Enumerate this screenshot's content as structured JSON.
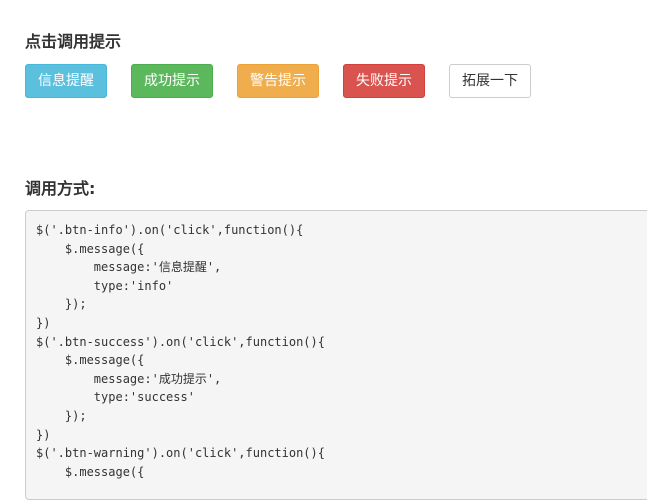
{
  "section1": {
    "title": "点击调用提示"
  },
  "buttons": {
    "info": "信息提醒",
    "success": "成功提示",
    "warning": "警告提示",
    "danger": "失败提示",
    "extend": "拓展一下"
  },
  "section2": {
    "title": "调用方式:"
  },
  "code": {
    "lines": [
      "$('.btn-info').on('click',function(){",
      "    $.message({",
      "        message:'信息提醒',",
      "        type:'info'",
      "    });",
      "})",
      "$('.btn-success').on('click',function(){",
      "    $.message({",
      "        message:'成功提示',",
      "        type:'success'",
      "    });",
      "})",
      "$('.btn-warning').on('click',function(){",
      "    $.message({"
    ]
  },
  "colors": {
    "info": "#5bc0de",
    "success": "#5cb85c",
    "warning": "#f0ad4e",
    "danger": "#d9534f",
    "default": "#ffffff",
    "code_bg": "#f5f5f5"
  }
}
